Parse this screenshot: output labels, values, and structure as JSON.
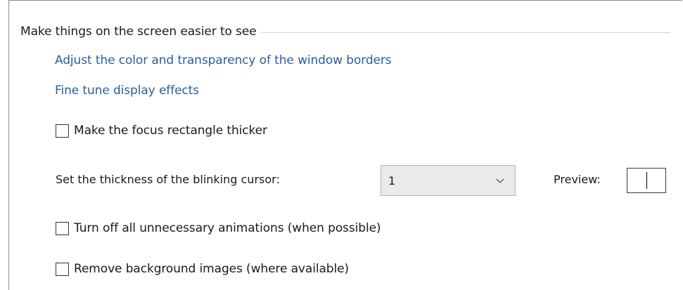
{
  "group": {
    "title": "Make things on the screen easier to see"
  },
  "links": {
    "window_borders": "Adjust the color and transparency of the window borders",
    "display_effects": "Fine tune display effects"
  },
  "options": {
    "focus_rectangle": {
      "label": "Make the focus rectangle thicker",
      "checked": false
    },
    "animations": {
      "label": "Turn off all unnecessary animations (when possible)",
      "checked": false
    },
    "background_images": {
      "label": "Remove background images (where available)",
      "checked": false
    }
  },
  "cursor": {
    "label": "Set the thickness of the blinking cursor:",
    "selected": "1",
    "preview_label": "Preview:"
  },
  "colors": {
    "link": "#2a5e9b",
    "text": "#1a1a1a",
    "select_bg": "#eaeaea"
  },
  "icons": {
    "dropdown": "chevron-down-icon"
  }
}
